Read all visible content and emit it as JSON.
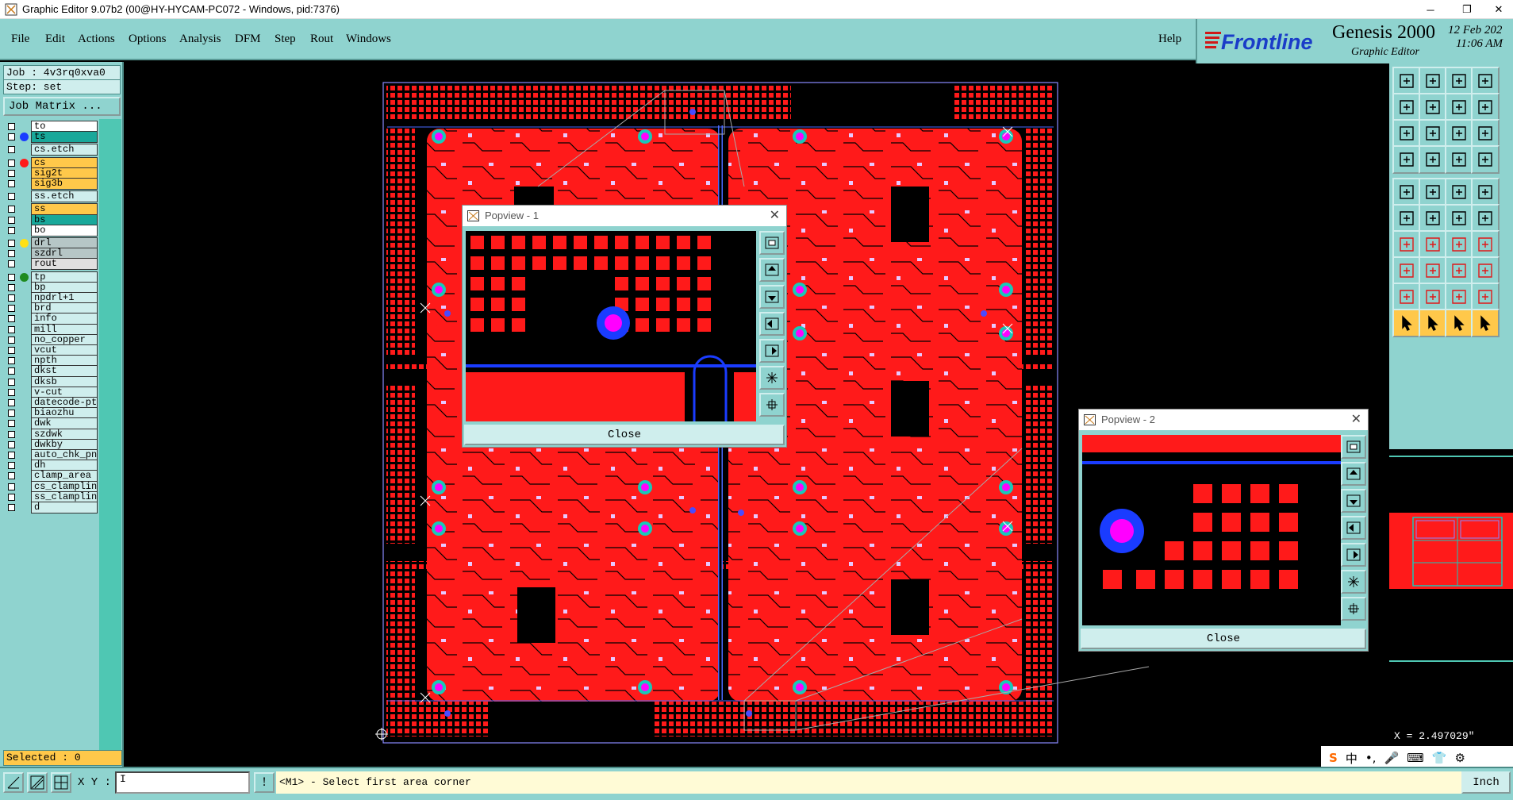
{
  "window": {
    "title": "Graphic Editor 9.07b2 (00@HY-HYCAM-PC072 - Windows, pid:7376)",
    "minimize": "─",
    "restore": "❐",
    "close": "✕"
  },
  "menu": {
    "items": [
      "File",
      "Edit",
      "Actions",
      "Options",
      "Analysis",
      "DFM",
      "Step",
      "Rout",
      "Windows"
    ],
    "help": "Help"
  },
  "brand": {
    "logo": "Frontline",
    "title": "Genesis 2000",
    "subtitle": "Graphic Editor",
    "date": "12 Feb 202",
    "time": "11:06 AM"
  },
  "job": {
    "job_label": "Job : 4v3rq0xva0",
    "step_label": "Step: set",
    "matrix_button": "Job Matrix ..."
  },
  "layers": [
    {
      "name": "to",
      "color": "#ffffff",
      "dot": "",
      "checked": false
    },
    {
      "name": "ts",
      "color": "#19a89a",
      "dot": "#1a3cff",
      "checked": false
    },
    {
      "name": "cs.etch",
      "color": "#cfeeed",
      "dot": "",
      "checked": false
    },
    {
      "name": "cs",
      "color": "#ffc84a",
      "dot": "#ff1a1a",
      "checked": true
    },
    {
      "name": "sig2t",
      "color": "#ffc84a",
      "dot": "",
      "checked": false
    },
    {
      "name": "sig3b",
      "color": "#ffc84a",
      "dot": "",
      "checked": false
    },
    {
      "name": "ss.etch",
      "color": "#cfeeed",
      "dot": "",
      "checked": false
    },
    {
      "name": "ss",
      "color": "#ffc84a",
      "dot": "",
      "checked": false
    },
    {
      "name": "bs",
      "color": "#19a89a",
      "dot": "",
      "checked": false
    },
    {
      "name": "bo",
      "color": "#ffffff",
      "dot": "",
      "checked": false
    },
    {
      "name": "drl",
      "color": "#b6c6c6",
      "dot": "#ffe014",
      "checked": false
    },
    {
      "name": "szdrl",
      "color": "#b6c6c6",
      "dot": "",
      "checked": false
    },
    {
      "name": "rout",
      "color": "#e0e0e0",
      "dot": "",
      "checked": false
    },
    {
      "name": "tp",
      "color": "#cfeeed",
      "dot": "#1f8a1f",
      "checked": false
    },
    {
      "name": "bp",
      "color": "#cfeeed",
      "dot": "",
      "checked": false
    },
    {
      "name": "npdrl+1",
      "color": "#cfeeed",
      "dot": "",
      "checked": false
    },
    {
      "name": "brd",
      "color": "#cfeeed",
      "dot": "",
      "checked": false
    },
    {
      "name": "info",
      "color": "#cfeeed",
      "dot": "",
      "checked": false
    },
    {
      "name": "mill",
      "color": "#cfeeed",
      "dot": "",
      "checked": false
    },
    {
      "name": "no_copper",
      "color": "#cfeeed",
      "dot": "",
      "checked": false
    },
    {
      "name": "vcut",
      "color": "#cfeeed",
      "dot": "",
      "checked": false
    },
    {
      "name": "npth",
      "color": "#cfeeed",
      "dot": "",
      "checked": false
    },
    {
      "name": "dkst",
      "color": "#cfeeed",
      "dot": "",
      "checked": false
    },
    {
      "name": "dksb",
      "color": "#cfeeed",
      "dot": "",
      "checked": false
    },
    {
      "name": "v-cut",
      "color": "#cfeeed",
      "dot": "",
      "checked": false
    },
    {
      "name": "datecode-pt",
      "color": "#cfeeed",
      "dot": "",
      "checked": false
    },
    {
      "name": "biaozhu",
      "color": "#cfeeed",
      "dot": "",
      "checked": false
    },
    {
      "name": "dwk",
      "color": "#cfeeed",
      "dot": "",
      "checked": false
    },
    {
      "name": "szdwk",
      "color": "#cfeeed",
      "dot": "",
      "checked": false
    },
    {
      "name": "dwkby",
      "color": "#cfeeed",
      "dot": "",
      "checked": false
    },
    {
      "name": "auto_chk_pn",
      "color": "#cfeeed",
      "dot": "",
      "checked": false
    },
    {
      "name": "dh",
      "color": "#cfeeed",
      "dot": "",
      "checked": false
    },
    {
      "name": "clamp_area",
      "color": "#cfeeed",
      "dot": "",
      "checked": false
    },
    {
      "name": "cs_clamplin",
      "color": "#cfeeed",
      "dot": "",
      "checked": false
    },
    {
      "name": "ss_clamplin",
      "color": "#cfeeed",
      "dot": "",
      "checked": false
    },
    {
      "name": "d",
      "color": "#cfeeed",
      "dot": "",
      "checked": false
    }
  ],
  "selected": "Selected : 0",
  "popview1": {
    "title": "Popview - 1",
    "close": "Close",
    "close_x": "✕"
  },
  "popview2": {
    "title": "Popview - 2",
    "close": "Close",
    "close_x": "✕"
  },
  "bottom": {
    "xy_label": "X Y :",
    "xy_value": "I",
    "prompt_icon": "!",
    "prompt": "<M1> - Select first area corner",
    "unit": "Inch"
  },
  "coord_readout": "X = 2.497029\"",
  "ime": [
    "S",
    "中",
    "•,",
    "🎤",
    "⌨",
    "👕",
    "⚙"
  ],
  "colors": {
    "panel": "#8fd3cf",
    "copper": "#ff1a1a",
    "via_outer": "#1a3cff",
    "via_inner": "#ff00ff",
    "highlight": "#ffc84a"
  }
}
